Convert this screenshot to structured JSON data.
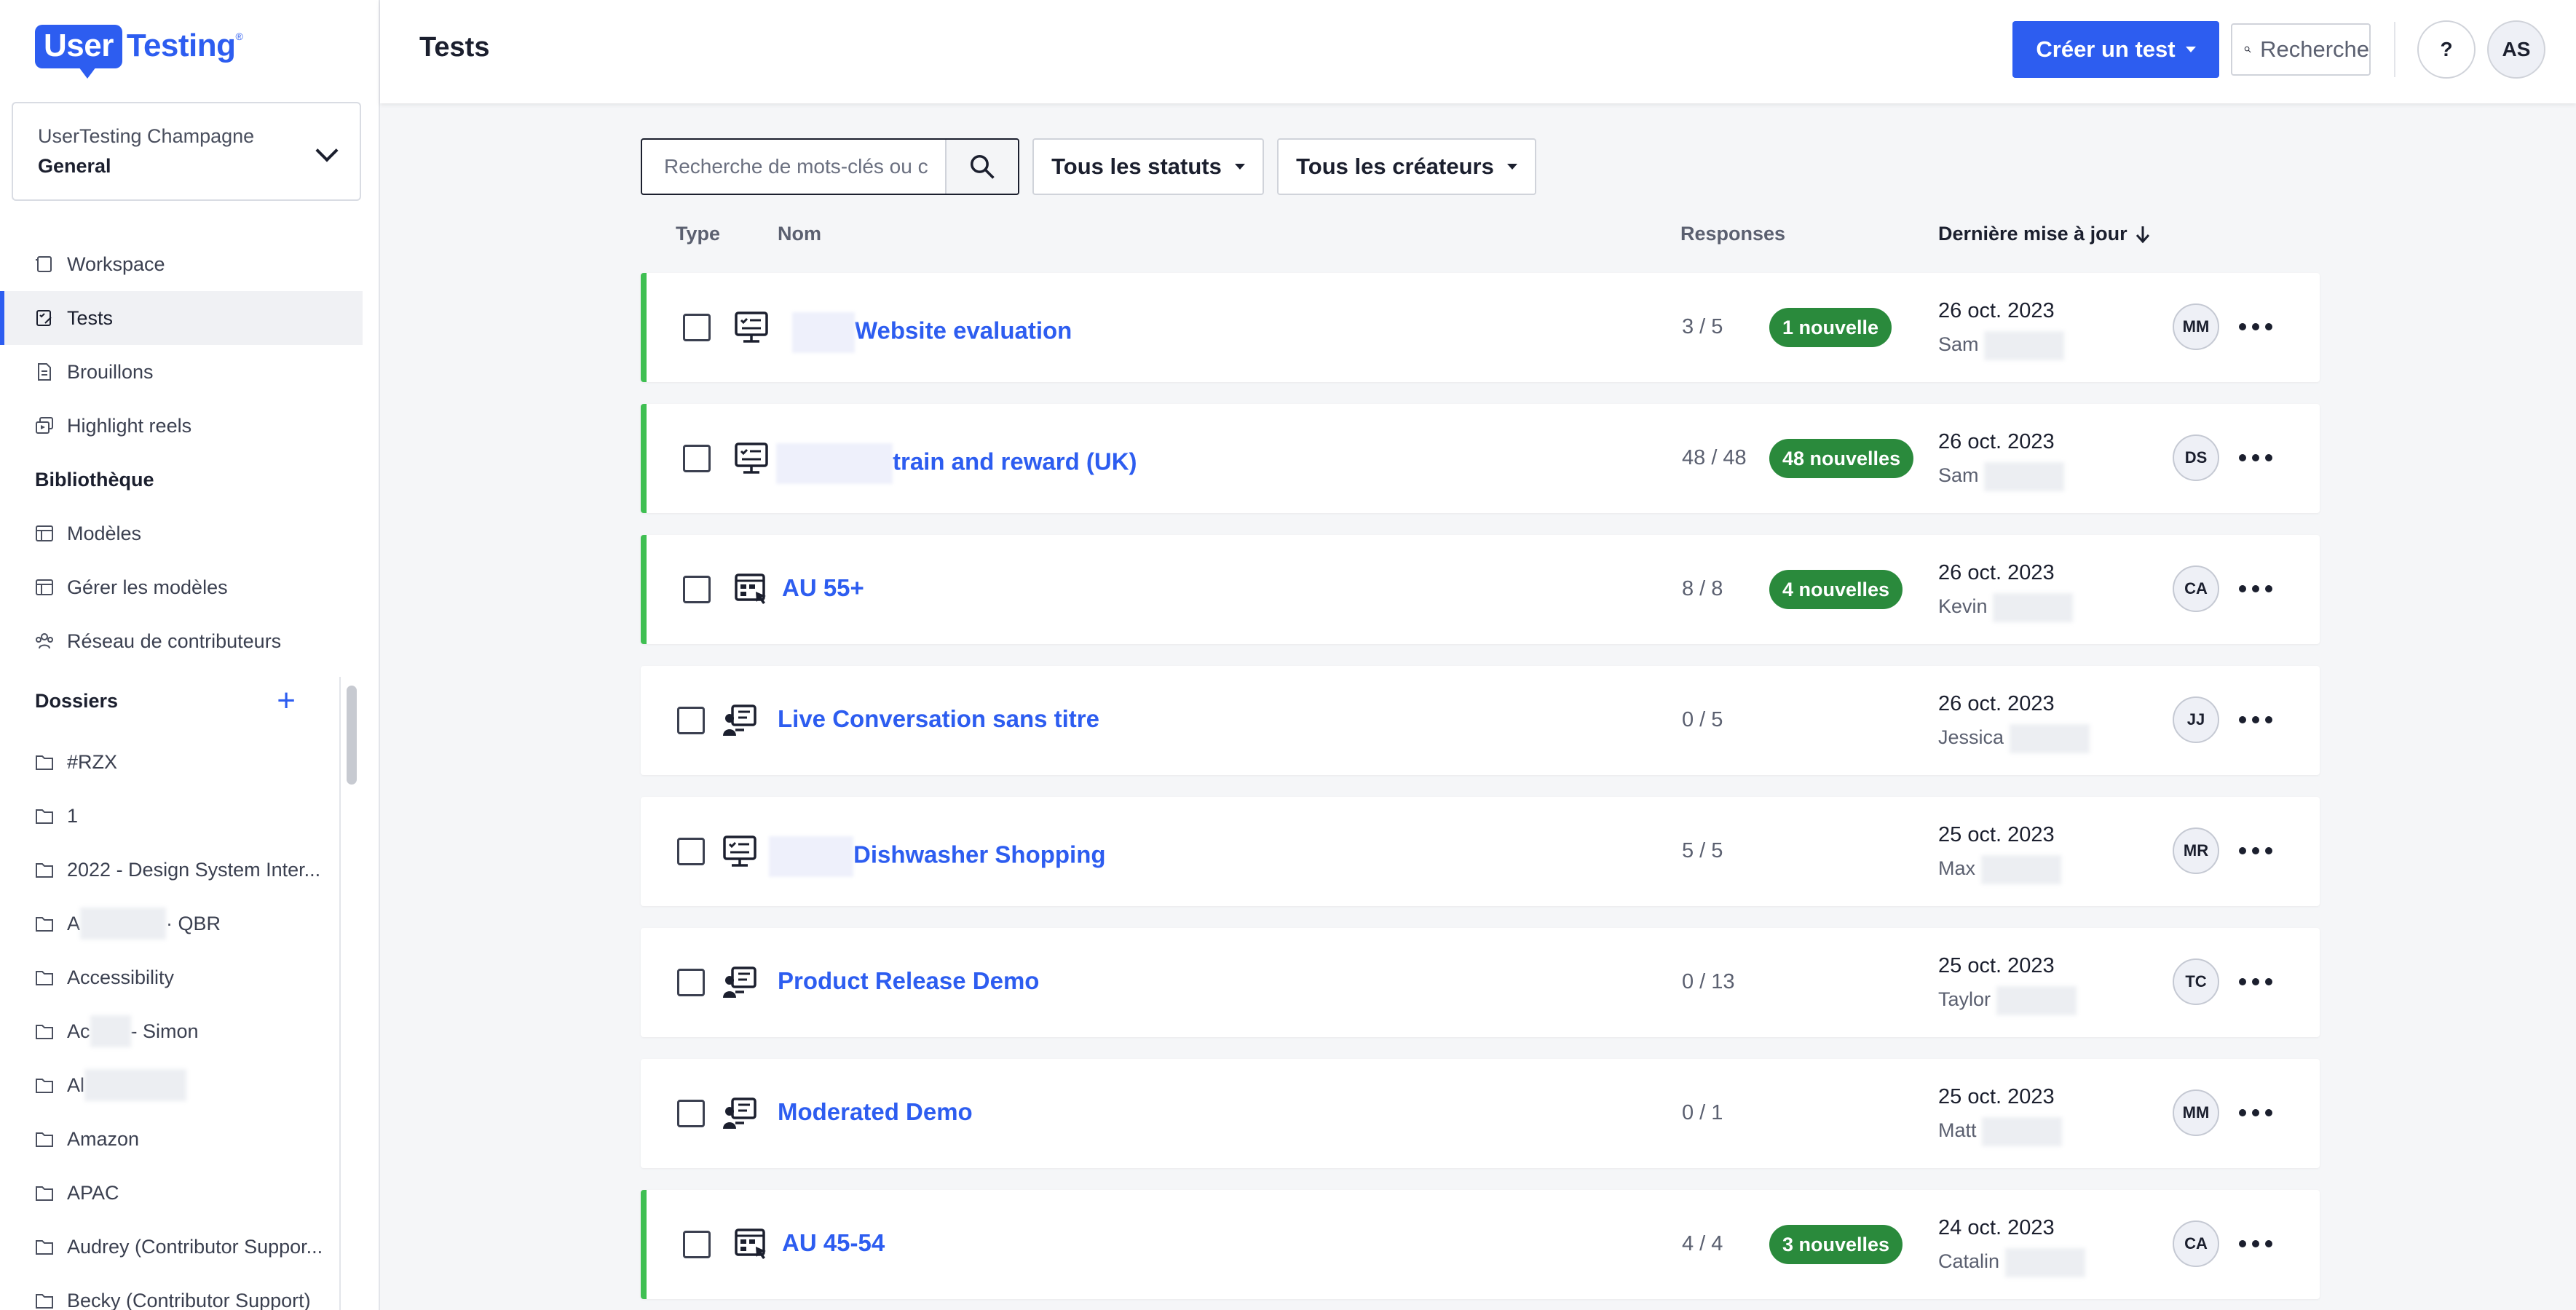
{
  "brand": {
    "logo_user": "User",
    "logo_testing": "Testing",
    "logo_tm": "®",
    "accent": "#2d5df0",
    "new_green": "#2a8a3c",
    "row_new_border": "#3fbf52"
  },
  "workspace": {
    "org": "UserTesting Champagne",
    "name": "General"
  },
  "nav": {
    "workspace": "Workspace",
    "tests": "Tests",
    "drafts": "Brouillons",
    "highlight_reels": "Highlight reels",
    "library_section": "Bibliothèque",
    "templates": "Modèles",
    "manage_templates": "Gérer les modèles",
    "contributor_network": "Réseau de contributeurs",
    "folders_section": "Dossiers"
  },
  "folders": [
    {
      "label": "#RZX"
    },
    {
      "label": "1"
    },
    {
      "label": "2022 - Design System Inter..."
    },
    {
      "pre": "A",
      "post": "· QBR"
    },
    {
      "label": "Accessibility"
    },
    {
      "pre": "Ac",
      "post": "- Simon"
    },
    {
      "pre": "Al",
      "post": ""
    },
    {
      "label": "Amazon"
    },
    {
      "label": "APAC"
    },
    {
      "label": "Audrey (Contributor Suppor..."
    },
    {
      "label": "Becky (Contributor Support)"
    }
  ],
  "header": {
    "title": "Tests",
    "create_button": "Créer un test",
    "search_placeholder": "Recherche",
    "help": "?",
    "user_initials": "AS"
  },
  "filters": {
    "search_placeholder": "Recherche de mots-clés ou c",
    "status": "Tous les statuts",
    "creators": "Tous les créateurs"
  },
  "table": {
    "col_type": "Type",
    "col_name": "Nom",
    "col_responses": "Responses",
    "col_updated": "Dernière mise à jour"
  },
  "rows": [
    {
      "type": "desktop-checklist",
      "name": "Website evaluation",
      "responses": "3 / 5",
      "badge": "1 nouvelle",
      "date": "26 oct. 2023",
      "author": "Sam",
      "initials": "MM",
      "is_new": true
    },
    {
      "type": "desktop-checklist",
      "name": "train and reward (UK)",
      "responses": "48 / 48",
      "badge": "48 nouvelles",
      "date": "26 oct. 2023",
      "author": "Sam",
      "initials": "DS",
      "is_new": true
    },
    {
      "type": "prototype",
      "name": "AU 55+",
      "responses": "8 / 8",
      "badge": "4 nouvelles",
      "date": "26 oct. 2023",
      "author": "Kevin",
      "initials": "CA",
      "is_new": true
    },
    {
      "type": "live-conversation",
      "name": "Live Conversation sans titre",
      "responses": "0 / 5",
      "badge": "",
      "date": "26 oct. 2023",
      "author": "Jessica",
      "initials": "JJ",
      "is_new": false
    },
    {
      "type": "desktop-checklist",
      "name": "Dishwasher Shopping",
      "responses": "5 / 5",
      "badge": "",
      "date": "25 oct. 2023",
      "author": "Max",
      "initials": "MR",
      "is_new": false
    },
    {
      "type": "live-conversation",
      "name": "Product Release Demo",
      "responses": "0 / 13",
      "badge": "",
      "date": "25 oct. 2023",
      "author": "Taylor",
      "initials": "TC",
      "is_new": false
    },
    {
      "type": "live-conversation",
      "name": "Moderated Demo",
      "responses": "0 / 1",
      "badge": "",
      "date": "25 oct. 2023",
      "author": "Matt",
      "initials": "MM",
      "is_new": false
    },
    {
      "type": "prototype",
      "name": "AU 45-54",
      "responses": "4 / 4",
      "badge": "3 nouvelles",
      "date": "24 oct. 2023",
      "author": "Catalin",
      "initials": "CA",
      "is_new": true
    }
  ]
}
